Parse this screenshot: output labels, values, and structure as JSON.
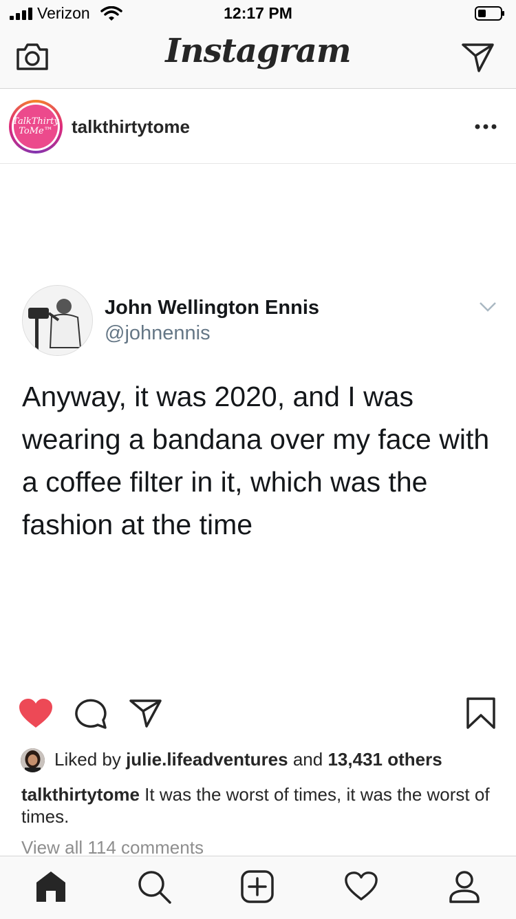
{
  "status_bar": {
    "carrier": "Verizon",
    "time": "12:17 PM"
  },
  "header": {
    "title": "Instagram",
    "left_icon": "camera-icon",
    "right_icon": "direct-message-icon"
  },
  "post": {
    "username": "talkthirtytome",
    "avatar_logo_text": "TalkThirty ToMe™",
    "more_icon": "more-horizontal-icon"
  },
  "tweet": {
    "name": "John Wellington Ennis",
    "handle": "@johnennis",
    "text": "Anyway, it was 2020, and I was wearing a bandana over my face with a coffee filter in it, which was the fashion at the time"
  },
  "actions": {
    "liked": true,
    "like_color": "#ed4956",
    "icons": [
      "heart-icon",
      "comment-icon",
      "share-icon",
      "bookmark-icon"
    ]
  },
  "likes": {
    "prefix": "Liked by",
    "liker": "julie.lifeadventures",
    "conjunction": "and",
    "others": "13,431 others"
  },
  "caption": {
    "username": "talkthirtytome",
    "text": "It was the worst of times, it was the worst of times."
  },
  "comments": {
    "view_all": "View all 114 comments"
  },
  "tab_bar": {
    "tabs": [
      "home-icon",
      "search-icon",
      "add-post-icon",
      "activity-icon",
      "profile-icon"
    ],
    "active": "home-icon"
  }
}
